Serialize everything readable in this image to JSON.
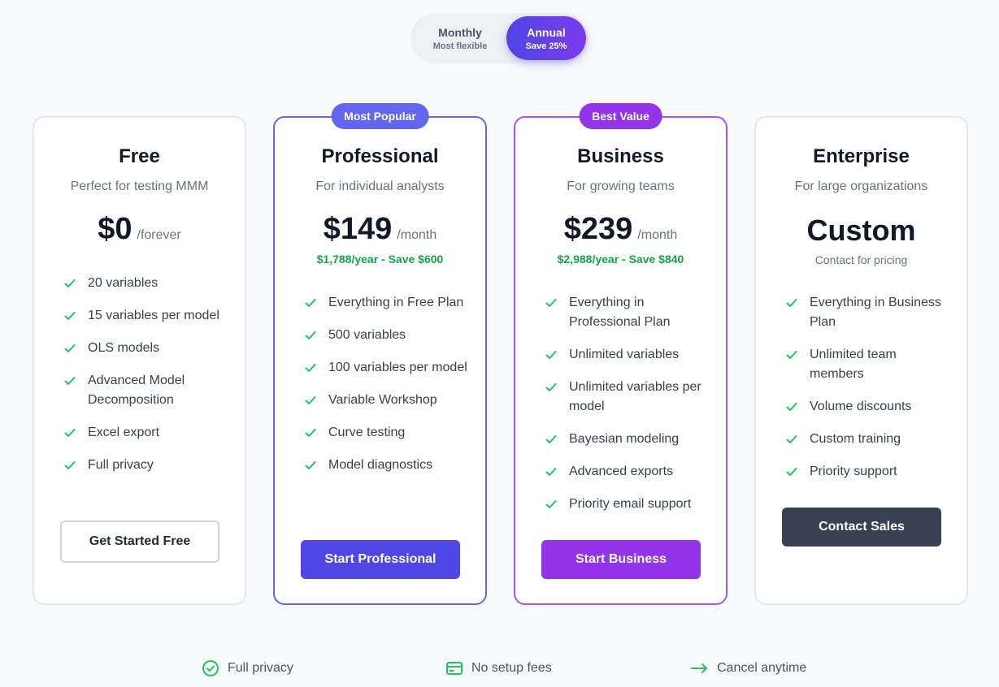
{
  "billing_toggle": {
    "monthly": {
      "label": "Monthly",
      "sub": "Most flexible",
      "selected": false
    },
    "annual": {
      "label": "Annual",
      "sub": "Save 25%",
      "selected": true
    }
  },
  "colors": {
    "check": "#22c55e",
    "professional_accent": "#4f46e5",
    "business_accent": "#9333ea",
    "enterprise_button": "#374151",
    "savings_text": "#16a34a"
  },
  "plans": [
    {
      "name": "Free",
      "description": "Perfect for testing MMM",
      "price": "$0",
      "period": "/forever",
      "features": [
        "20 variables",
        "15 variables per model",
        "OLS models",
        "Advanced Model Decomposition",
        "Excel export",
        "Full privacy"
      ],
      "cta": "Get Started Free"
    },
    {
      "name": "Professional",
      "badge": "Most Popular",
      "description": "For individual analysts",
      "price": "$149",
      "period": "/month",
      "savings": "$1,788/year - Save $600",
      "features": [
        "Everything in Free Plan",
        "500 variables",
        "100 variables per model",
        "Variable Workshop",
        "Curve testing",
        "Model diagnostics"
      ],
      "cta": "Start Professional"
    },
    {
      "name": "Business",
      "badge": "Best Value",
      "description": "For growing teams",
      "price": "$239",
      "period": "/month",
      "savings": "$2,988/year - Save $840",
      "features": [
        "Everything in Professional Plan",
        "Unlimited variables",
        "Unlimited variables per model",
        "Bayesian modeling",
        "Advanced exports",
        "Priority email support"
      ],
      "cta": "Start Business"
    },
    {
      "name": "Enterprise",
      "description": "For large organizations",
      "price": "Custom",
      "price_note": "Contact for pricing",
      "features": [
        "Everything in Business Plan",
        "Unlimited team members",
        "Volume discounts",
        "Custom training",
        "Priority support"
      ],
      "cta": "Contact Sales"
    }
  ],
  "perks": [
    {
      "icon": "check-circle-icon",
      "label": "Full privacy"
    },
    {
      "icon": "credit-card-icon",
      "label": "No setup fees"
    },
    {
      "icon": "arrow-right-icon",
      "label": "Cancel anytime"
    }
  ]
}
